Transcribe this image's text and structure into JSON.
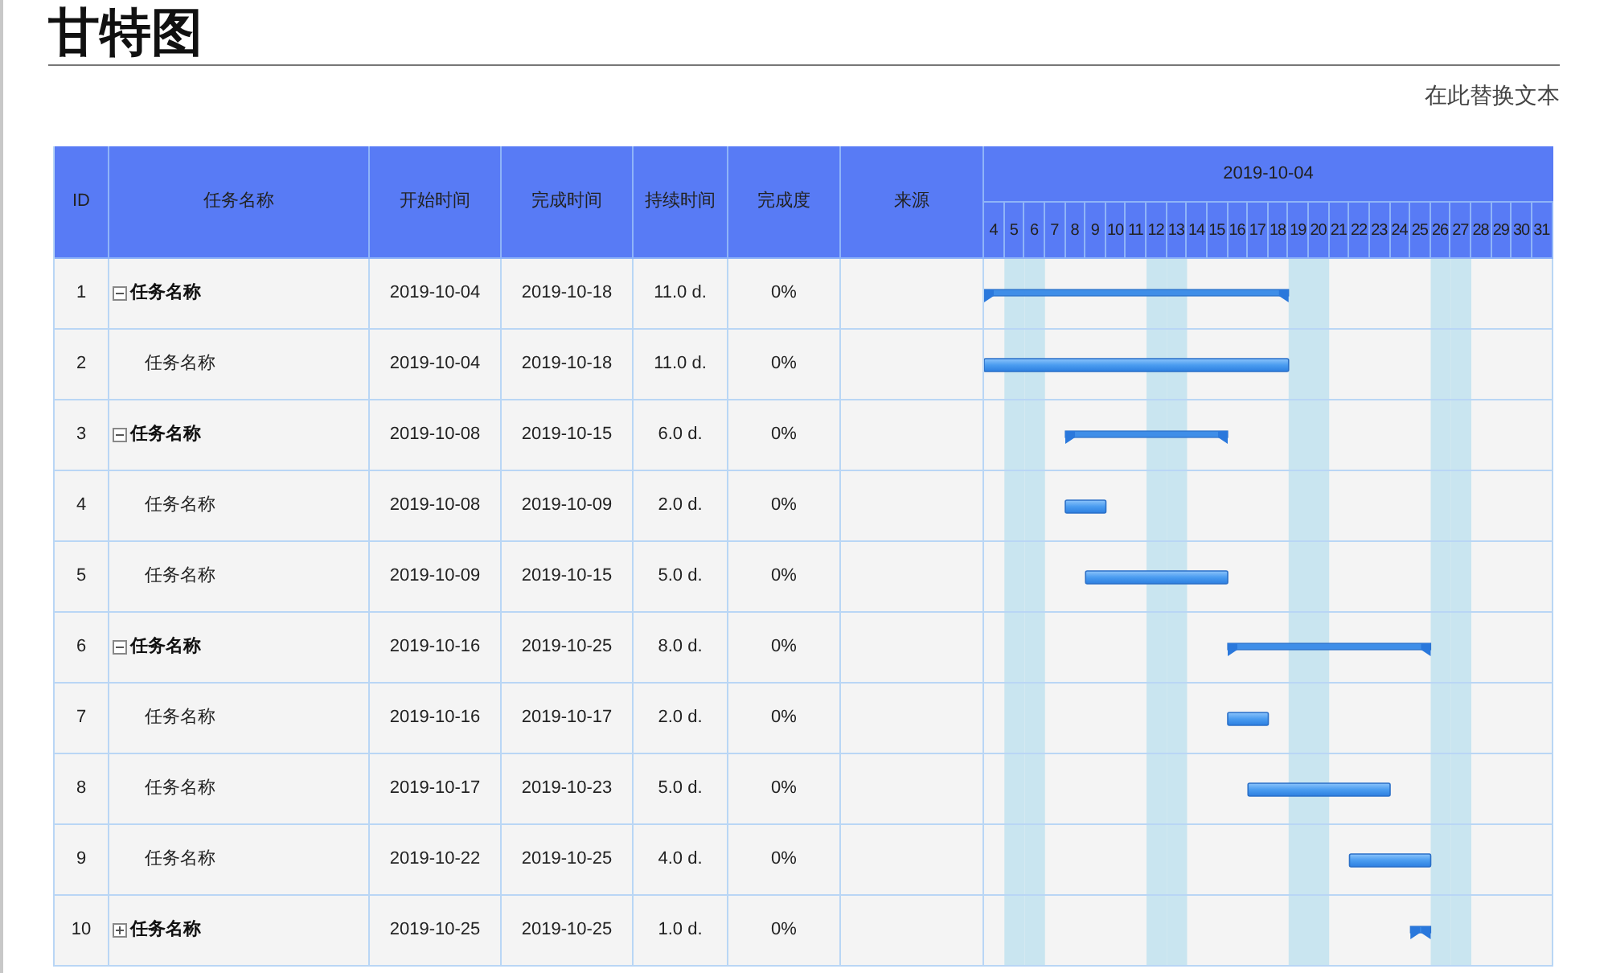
{
  "title": "甘特图",
  "subtitle": "在此替换文本",
  "columns": [
    "ID",
    "任务名称",
    "开始时间",
    "完成时间",
    "持续时间",
    "完成度",
    "来源"
  ],
  "timeline": {
    "title": "2019-10-04",
    "days": [
      {
        "label": "4",
        "weekend": false
      },
      {
        "label": "5",
        "weekend": true
      },
      {
        "label": "6",
        "weekend": true
      },
      {
        "label": "7",
        "weekend": false
      },
      {
        "label": "8",
        "weekend": false
      },
      {
        "label": "9",
        "weekend": false
      },
      {
        "label": "10",
        "weekend": false
      },
      {
        "label": "11",
        "weekend": false
      },
      {
        "label": "12",
        "weekend": true
      },
      {
        "label": "13",
        "weekend": true
      },
      {
        "label": "14",
        "weekend": false
      },
      {
        "label": "15",
        "weekend": false
      },
      {
        "label": "16",
        "weekend": false
      },
      {
        "label": "17",
        "weekend": false
      },
      {
        "label": "18",
        "weekend": false
      },
      {
        "label": "19",
        "weekend": true
      },
      {
        "label": "20",
        "weekend": true
      },
      {
        "label": "21",
        "weekend": false
      },
      {
        "label": "22",
        "weekend": false
      },
      {
        "label": "23",
        "weekend": false
      },
      {
        "label": "24",
        "weekend": false
      },
      {
        "label": "25",
        "weekend": false
      },
      {
        "label": "26",
        "weekend": true
      },
      {
        "label": "27",
        "weekend": true
      },
      {
        "label": "28",
        "weekend": false
      },
      {
        "label": "29",
        "weekend": false
      },
      {
        "label": "30",
        "weekend": false
      },
      {
        "label": "31",
        "weekend": false
      }
    ]
  },
  "rows": [
    {
      "id": "1",
      "kind": "summary",
      "expanded": true,
      "name": "任务名称",
      "start": "2019-10-04",
      "finish": "2019-10-18",
      "duration": "11.0 d.",
      "complete": "0%"
    },
    {
      "id": "2",
      "kind": "task",
      "name": "任务名称",
      "start": "2019-10-04",
      "finish": "2019-10-18",
      "duration": "11.0 d.",
      "complete": "0%"
    },
    {
      "id": "3",
      "kind": "summary",
      "expanded": true,
      "name": "任务名称",
      "start": "2019-10-08",
      "finish": "2019-10-15",
      "duration": "6.0 d.",
      "complete": "0%"
    },
    {
      "id": "4",
      "kind": "task",
      "name": "任务名称",
      "start": "2019-10-08",
      "finish": "2019-10-09",
      "duration": "2.0 d.",
      "complete": "0%"
    },
    {
      "id": "5",
      "kind": "task",
      "name": "任务名称",
      "start": "2019-10-09",
      "finish": "2019-10-15",
      "duration": "5.0 d.",
      "complete": "0%"
    },
    {
      "id": "6",
      "kind": "summary",
      "expanded": true,
      "name": "任务名称",
      "start": "2019-10-16",
      "finish": "2019-10-25",
      "duration": "8.0 d.",
      "complete": "0%"
    },
    {
      "id": "7",
      "kind": "task",
      "name": "任务名称",
      "start": "2019-10-16",
      "finish": "2019-10-17",
      "duration": "2.0 d.",
      "complete": "0%"
    },
    {
      "id": "8",
      "kind": "task",
      "name": "任务名称",
      "start": "2019-10-17",
      "finish": "2019-10-23",
      "duration": "5.0 d.",
      "complete": "0%"
    },
    {
      "id": "9",
      "kind": "task",
      "name": "任务名称",
      "start": "2019-10-22",
      "finish": "2019-10-25",
      "duration": "4.0 d.",
      "complete": "0%"
    },
    {
      "id": "10",
      "kind": "summary",
      "expanded": false,
      "name": "任务名称",
      "start": "2019-10-25",
      "finish": "2019-10-25",
      "duration": "1.0 d.",
      "complete": "0%"
    }
  ]
}
